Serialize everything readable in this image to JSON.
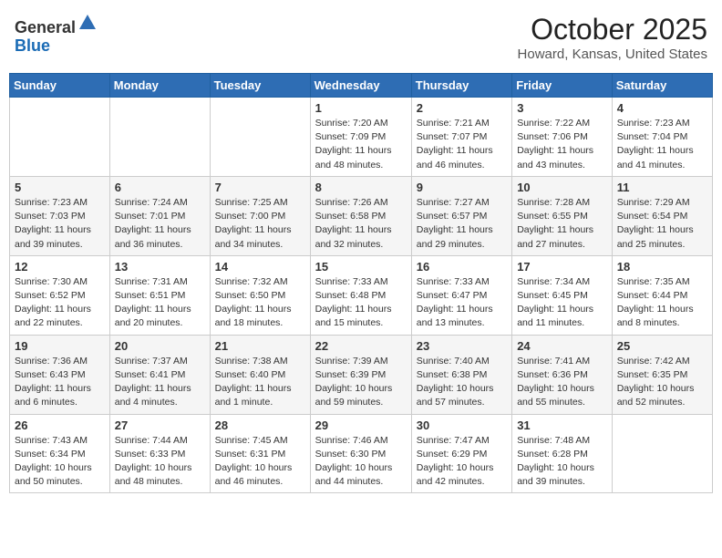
{
  "header": {
    "logo_line1": "General",
    "logo_line2": "Blue",
    "title": "October 2025",
    "subtitle": "Howard, Kansas, United States"
  },
  "days_of_week": [
    "Sunday",
    "Monday",
    "Tuesday",
    "Wednesday",
    "Thursday",
    "Friday",
    "Saturday"
  ],
  "weeks": [
    [
      {
        "day": "",
        "info": ""
      },
      {
        "day": "",
        "info": ""
      },
      {
        "day": "",
        "info": ""
      },
      {
        "day": "1",
        "info": "Sunrise: 7:20 AM\nSunset: 7:09 PM\nDaylight: 11 hours and 48 minutes."
      },
      {
        "day": "2",
        "info": "Sunrise: 7:21 AM\nSunset: 7:07 PM\nDaylight: 11 hours and 46 minutes."
      },
      {
        "day": "3",
        "info": "Sunrise: 7:22 AM\nSunset: 7:06 PM\nDaylight: 11 hours and 43 minutes."
      },
      {
        "day": "4",
        "info": "Sunrise: 7:23 AM\nSunset: 7:04 PM\nDaylight: 11 hours and 41 minutes."
      }
    ],
    [
      {
        "day": "5",
        "info": "Sunrise: 7:23 AM\nSunset: 7:03 PM\nDaylight: 11 hours and 39 minutes."
      },
      {
        "day": "6",
        "info": "Sunrise: 7:24 AM\nSunset: 7:01 PM\nDaylight: 11 hours and 36 minutes."
      },
      {
        "day": "7",
        "info": "Sunrise: 7:25 AM\nSunset: 7:00 PM\nDaylight: 11 hours and 34 minutes."
      },
      {
        "day": "8",
        "info": "Sunrise: 7:26 AM\nSunset: 6:58 PM\nDaylight: 11 hours and 32 minutes."
      },
      {
        "day": "9",
        "info": "Sunrise: 7:27 AM\nSunset: 6:57 PM\nDaylight: 11 hours and 29 minutes."
      },
      {
        "day": "10",
        "info": "Sunrise: 7:28 AM\nSunset: 6:55 PM\nDaylight: 11 hours and 27 minutes."
      },
      {
        "day": "11",
        "info": "Sunrise: 7:29 AM\nSunset: 6:54 PM\nDaylight: 11 hours and 25 minutes."
      }
    ],
    [
      {
        "day": "12",
        "info": "Sunrise: 7:30 AM\nSunset: 6:52 PM\nDaylight: 11 hours and 22 minutes."
      },
      {
        "day": "13",
        "info": "Sunrise: 7:31 AM\nSunset: 6:51 PM\nDaylight: 11 hours and 20 minutes."
      },
      {
        "day": "14",
        "info": "Sunrise: 7:32 AM\nSunset: 6:50 PM\nDaylight: 11 hours and 18 minutes."
      },
      {
        "day": "15",
        "info": "Sunrise: 7:33 AM\nSunset: 6:48 PM\nDaylight: 11 hours and 15 minutes."
      },
      {
        "day": "16",
        "info": "Sunrise: 7:33 AM\nSunset: 6:47 PM\nDaylight: 11 hours and 13 minutes."
      },
      {
        "day": "17",
        "info": "Sunrise: 7:34 AM\nSunset: 6:45 PM\nDaylight: 11 hours and 11 minutes."
      },
      {
        "day": "18",
        "info": "Sunrise: 7:35 AM\nSunset: 6:44 PM\nDaylight: 11 hours and 8 minutes."
      }
    ],
    [
      {
        "day": "19",
        "info": "Sunrise: 7:36 AM\nSunset: 6:43 PM\nDaylight: 11 hours and 6 minutes."
      },
      {
        "day": "20",
        "info": "Sunrise: 7:37 AM\nSunset: 6:41 PM\nDaylight: 11 hours and 4 minutes."
      },
      {
        "day": "21",
        "info": "Sunrise: 7:38 AM\nSunset: 6:40 PM\nDaylight: 11 hours and 1 minute."
      },
      {
        "day": "22",
        "info": "Sunrise: 7:39 AM\nSunset: 6:39 PM\nDaylight: 10 hours and 59 minutes."
      },
      {
        "day": "23",
        "info": "Sunrise: 7:40 AM\nSunset: 6:38 PM\nDaylight: 10 hours and 57 minutes."
      },
      {
        "day": "24",
        "info": "Sunrise: 7:41 AM\nSunset: 6:36 PM\nDaylight: 10 hours and 55 minutes."
      },
      {
        "day": "25",
        "info": "Sunrise: 7:42 AM\nSunset: 6:35 PM\nDaylight: 10 hours and 52 minutes."
      }
    ],
    [
      {
        "day": "26",
        "info": "Sunrise: 7:43 AM\nSunset: 6:34 PM\nDaylight: 10 hours and 50 minutes."
      },
      {
        "day": "27",
        "info": "Sunrise: 7:44 AM\nSunset: 6:33 PM\nDaylight: 10 hours and 48 minutes."
      },
      {
        "day": "28",
        "info": "Sunrise: 7:45 AM\nSunset: 6:31 PM\nDaylight: 10 hours and 46 minutes."
      },
      {
        "day": "29",
        "info": "Sunrise: 7:46 AM\nSunset: 6:30 PM\nDaylight: 10 hours and 44 minutes."
      },
      {
        "day": "30",
        "info": "Sunrise: 7:47 AM\nSunset: 6:29 PM\nDaylight: 10 hours and 42 minutes."
      },
      {
        "day": "31",
        "info": "Sunrise: 7:48 AM\nSunset: 6:28 PM\nDaylight: 10 hours and 39 minutes."
      },
      {
        "day": "",
        "info": ""
      }
    ]
  ]
}
